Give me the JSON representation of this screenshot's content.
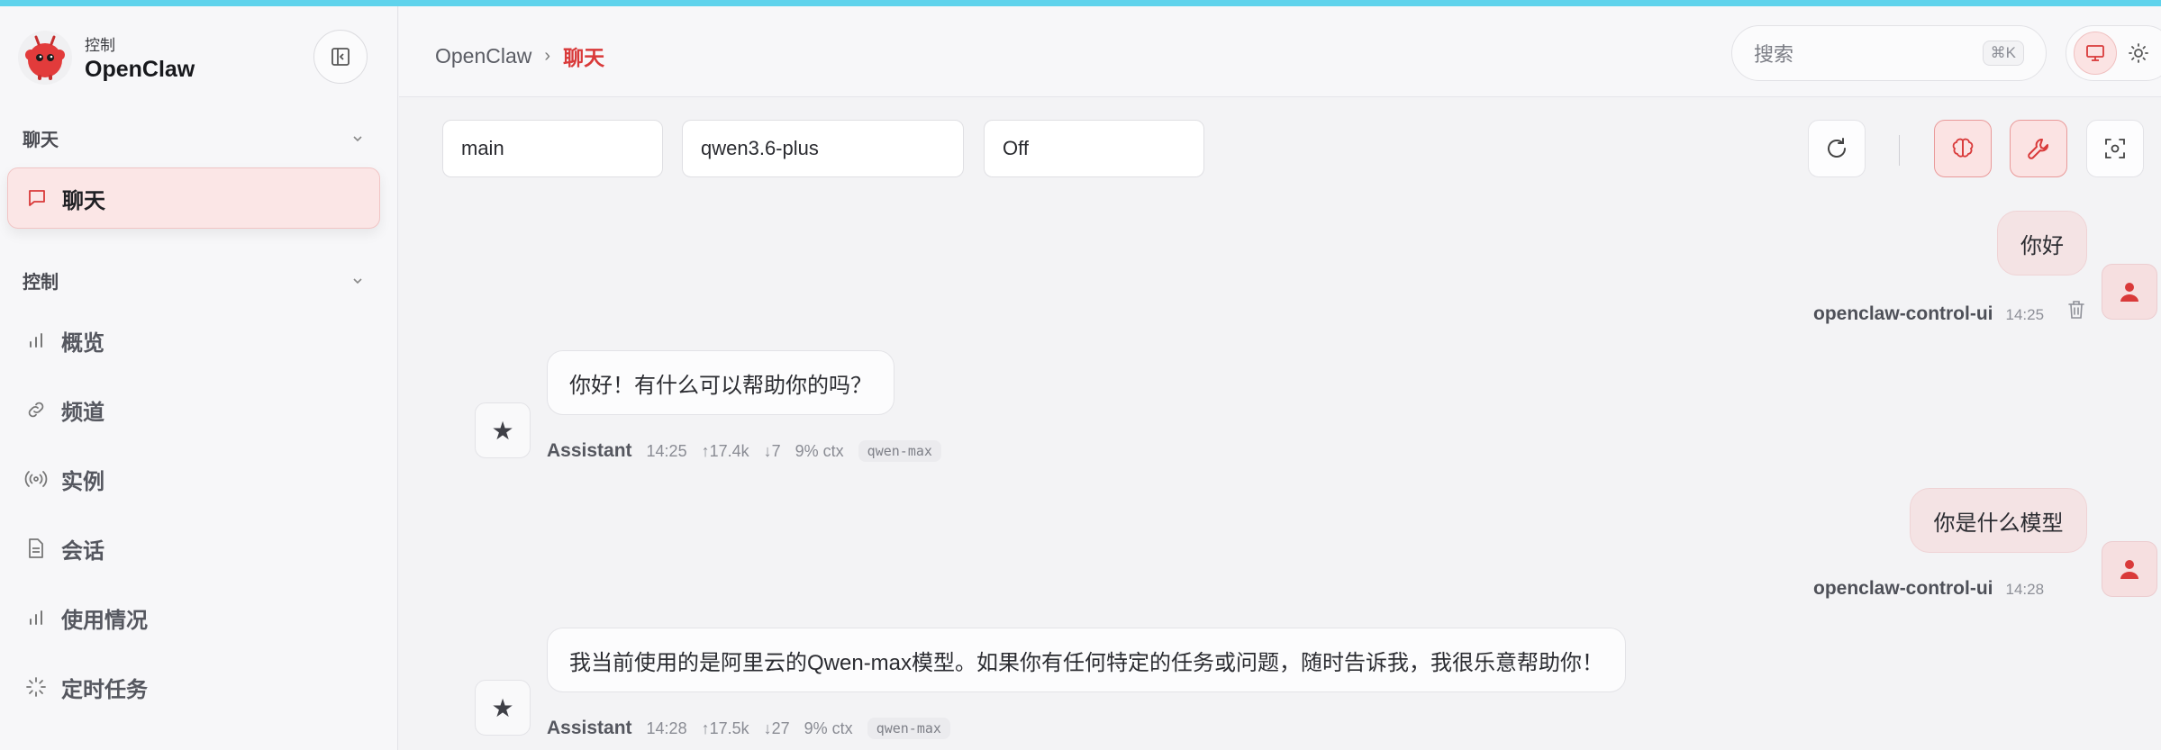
{
  "app": {
    "brand_sub": "控制",
    "brand_name": "OpenClaw",
    "accent": "#5fd3ec",
    "brand_color": "#d93a3a"
  },
  "sidebar": {
    "group_chat": "聊天",
    "chat_item": "聊天",
    "group_control": "控制",
    "items": [
      {
        "label": "概览",
        "icon": "bar-chart-icon"
      },
      {
        "label": "频道",
        "icon": "link-icon"
      },
      {
        "label": "实例",
        "icon": "broadcast-icon"
      },
      {
        "label": "会话",
        "icon": "document-icon"
      },
      {
        "label": "使用情况",
        "icon": "bar-chart-icon"
      },
      {
        "label": "定时任务",
        "icon": "loader-icon"
      }
    ]
  },
  "header": {
    "breadcrumb_root": "OpenClaw",
    "breadcrumb_sep": "›",
    "breadcrumb_current": "聊天",
    "search_placeholder": "搜索",
    "search_shortcut": "⌘K"
  },
  "toolbar": {
    "agent_select": "main",
    "model_select": "qwen3.6-plus",
    "thinking_select": "Off"
  },
  "messages": [
    {
      "role": "user",
      "text": "你好",
      "sender": "openclaw-control-ui",
      "time": "14:25"
    },
    {
      "role": "assistant",
      "text": "你好！有什么可以帮助你的吗？",
      "sender": "Assistant",
      "time": "14:25",
      "tokens_in": "↑17.4k",
      "tokens_out": "↓7",
      "ctx": "9% ctx",
      "model": "qwen-max"
    },
    {
      "role": "user",
      "text": "你是什么模型",
      "sender": "openclaw-control-ui",
      "time": "14:28"
    },
    {
      "role": "assistant",
      "text": "我当前使用的是阿里云的Qwen-max模型。如果你有任何特定的任务或问题，随时告诉我，我很乐意帮助你！",
      "sender": "Assistant",
      "time": "14:28",
      "tokens_in": "↑17.5k",
      "tokens_out": "↓27",
      "ctx": "9% ctx",
      "model": "qwen-max"
    }
  ]
}
